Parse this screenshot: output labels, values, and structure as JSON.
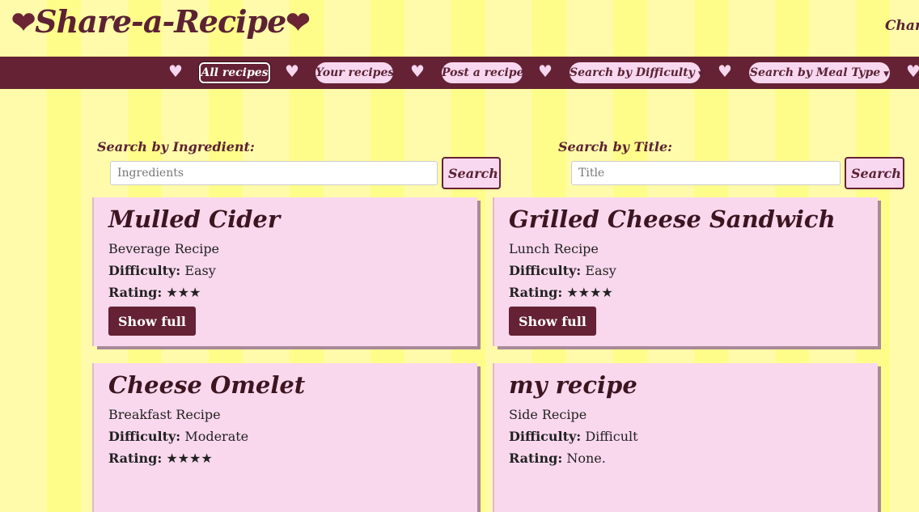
{
  "header": {
    "logo_heart_left": "❤",
    "logo_text": "Share-a-Recipe",
    "logo_heart_right": "❤",
    "change_link": "Chang"
  },
  "nav": {
    "heart_glyph": "♥",
    "items": [
      {
        "label": "All recipes",
        "active": true
      },
      {
        "label": "Your recipes"
      },
      {
        "label": "Post a recipe"
      },
      {
        "label": "Search by Difficulty",
        "caret": "▼"
      },
      {
        "label": "Search by Meal Type",
        "caret": "▼"
      }
    ]
  },
  "search": {
    "ingredient": {
      "label": "Search by Ingredient:",
      "placeholder": "Ingredients",
      "button": "Search"
    },
    "title": {
      "label": "Search by Title:",
      "placeholder": "Title",
      "button": "Search"
    }
  },
  "cards": [
    {
      "title": "Mulled Cider",
      "type": "Beverage Recipe",
      "difficulty_label": "Difficulty:",
      "difficulty": "Easy",
      "rating_label": "Rating:",
      "rating": "★★★",
      "button": "Show full"
    },
    {
      "title": "Grilled Cheese Sandwich",
      "type": "Lunch Recipe",
      "difficulty_label": "Difficulty:",
      "difficulty": "Easy",
      "rating_label": "Rating:",
      "rating": "★★★★",
      "button": "Show full"
    },
    {
      "title": "Cheese Omelet",
      "type": "Breakfast Recipe",
      "difficulty_label": "Difficulty:",
      "difficulty": "Moderate",
      "rating_label": "Rating:",
      "rating": "★★★★"
    },
    {
      "title": "my recipe",
      "type": "Side Recipe",
      "difficulty_label": "Difficulty:",
      "difficulty": "Difficult",
      "rating_label": "Rating:",
      "rating": "None."
    }
  ],
  "colors": {
    "nav_bg": "#652234",
    "pill_bg": "#f8d8f0",
    "card_bg": "#f9d8ee",
    "stripe_a": "#fffbaa",
    "stripe_b": "#fffd8a"
  }
}
